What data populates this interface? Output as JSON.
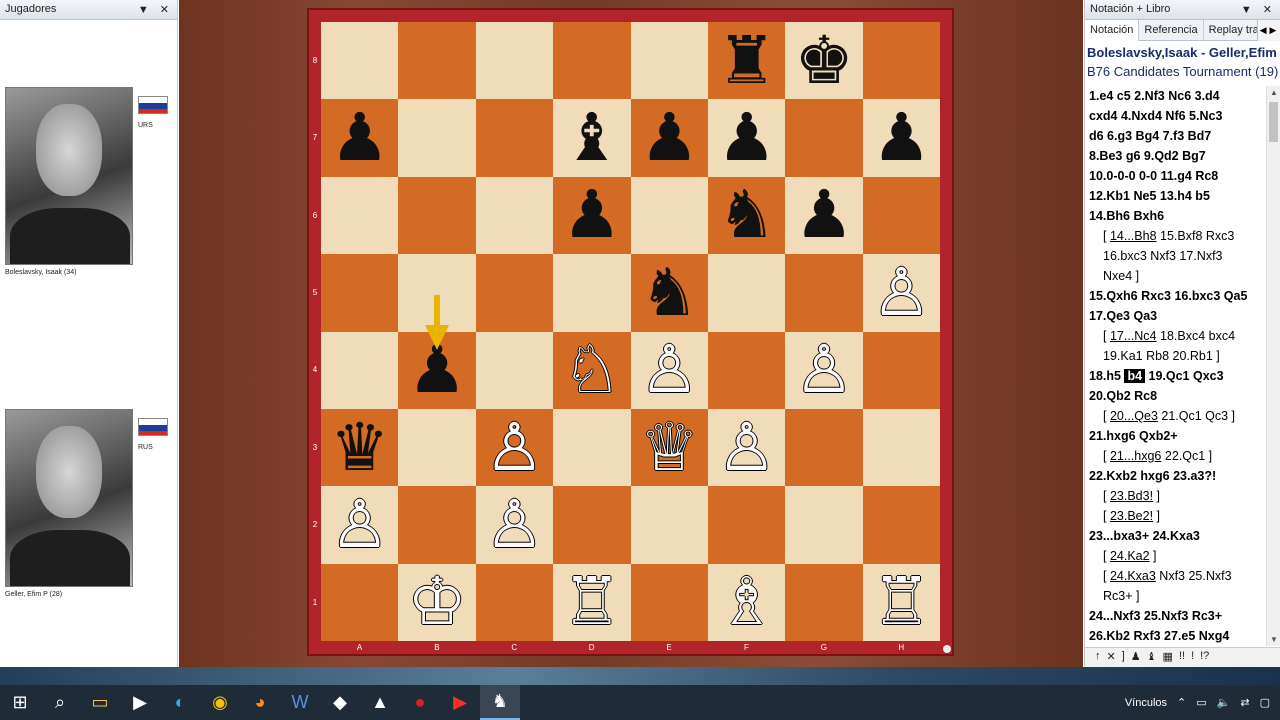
{
  "left_panel": {
    "title": "Jugadores",
    "players": [
      {
        "name": "Boleslavsky, Isaak  (34)",
        "country": "URS"
      },
      {
        "name": "Geller, Efim P  (28)",
        "country": "RUS"
      }
    ]
  },
  "board": {
    "ranks": [
      "8",
      "7",
      "6",
      "5",
      "4",
      "3",
      "2",
      "1"
    ],
    "files": [
      "A",
      "B",
      "C",
      "D",
      "E",
      "F",
      "G",
      "H"
    ],
    "pieces": [
      {
        "square": "f8",
        "glyph": "♜",
        "color": "b"
      },
      {
        "square": "g8",
        "glyph": "♚",
        "color": "b"
      },
      {
        "square": "a7",
        "glyph": "♟",
        "color": "b"
      },
      {
        "square": "d7",
        "glyph": "♝",
        "color": "b"
      },
      {
        "square": "e7",
        "glyph": "♟",
        "color": "b"
      },
      {
        "square": "f7",
        "glyph": "♟",
        "color": "b"
      },
      {
        "square": "h7",
        "glyph": "♟",
        "color": "b"
      },
      {
        "square": "d6",
        "glyph": "♟",
        "color": "b"
      },
      {
        "square": "f6",
        "glyph": "♞",
        "color": "b"
      },
      {
        "square": "g6",
        "glyph": "♟",
        "color": "b"
      },
      {
        "square": "e5",
        "glyph": "♞",
        "color": "b"
      },
      {
        "square": "h5",
        "glyph": "♙",
        "color": "w"
      },
      {
        "square": "b4",
        "glyph": "♟",
        "color": "b"
      },
      {
        "square": "d4",
        "glyph": "♘",
        "color": "w"
      },
      {
        "square": "e4",
        "glyph": "♙",
        "color": "w"
      },
      {
        "square": "g4",
        "glyph": "♙",
        "color": "w"
      },
      {
        "square": "a3",
        "glyph": "♛",
        "color": "b"
      },
      {
        "square": "c3",
        "glyph": "♙",
        "color": "w"
      },
      {
        "square": "e3",
        "glyph": "♕",
        "color": "w"
      },
      {
        "square": "f3",
        "glyph": "♙",
        "color": "w"
      },
      {
        "square": "a2",
        "glyph": "♙",
        "color": "w"
      },
      {
        "square": "c2",
        "glyph": "♙",
        "color": "w"
      },
      {
        "square": "b1",
        "glyph": "♔",
        "color": "w"
      },
      {
        "square": "d1",
        "glyph": "♖",
        "color": "w"
      },
      {
        "square": "f1",
        "glyph": "♗",
        "color": "w"
      },
      {
        "square": "h1",
        "glyph": "♖",
        "color": "w"
      }
    ],
    "last_move_arrow": {
      "from": "b5",
      "to": "b4",
      "color": "#e8b400"
    }
  },
  "right_panel": {
    "title": "Notación + Libro",
    "tabs": [
      "Notación",
      "Referencia",
      "Replay train"
    ],
    "white": "Boleslavsky,Isaak",
    "black": "Geller,Efim P",
    "event": "B76 Candidates Tournament (19)",
    "lines": [
      {
        "type": "main",
        "tokens": [
          {
            "t": "1.e4  c5  2.Nf3  Nc6  3.d4"
          }
        ]
      },
      {
        "type": "main",
        "tokens": [
          {
            "t": "cxd4  4.Nxd4  Nf6  5.Nc3"
          }
        ]
      },
      {
        "type": "main",
        "tokens": [
          {
            "t": "d6  6.g3  Bg4  7.f3  Bd7"
          }
        ]
      },
      {
        "type": "main",
        "tokens": [
          {
            "t": "8.Be3  g6  9.Qd2  Bg7"
          }
        ]
      },
      {
        "type": "main",
        "tokens": [
          {
            "t": "10.0-0-0  0-0  11.g4  Rc8"
          }
        ]
      },
      {
        "type": "main",
        "tokens": [
          {
            "t": "12.Kb1  Ne5  13.h4  b5"
          }
        ]
      },
      {
        "type": "main",
        "tokens": [
          {
            "t": "14.Bh6  Bxh6"
          }
        ]
      },
      {
        "type": "var",
        "tokens": [
          {
            "t": "[ "
          },
          {
            "t": "14...Bh8",
            "s": "sub"
          },
          {
            "t": "  15.Bxf8  Rxc3"
          }
        ]
      },
      {
        "type": "var",
        "tokens": [
          {
            "t": "16.bxc3  Nxf3  17.Nxf3"
          }
        ]
      },
      {
        "type": "var",
        "tokens": [
          {
            "t": "Nxe4 ]"
          }
        ]
      },
      {
        "type": "main",
        "tokens": [
          {
            "t": "15.Qxh6  Rxc3  16.bxc3  Qa5"
          }
        ]
      },
      {
        "type": "main",
        "tokens": [
          {
            "t": "17.Qe3  Qa3"
          }
        ]
      },
      {
        "type": "var",
        "tokens": [
          {
            "t": "[ "
          },
          {
            "t": "17...Nc4",
            "s": "sub"
          },
          {
            "t": "  18.Bxc4  bxc4"
          }
        ]
      },
      {
        "type": "var",
        "tokens": [
          {
            "t": "19.Ka1  Rb8  20.Rb1 ]"
          }
        ]
      },
      {
        "type": "main",
        "tokens": [
          {
            "t": "18.h5  "
          },
          {
            "t": "b4",
            "s": "current"
          },
          {
            "t": "  19.Qc1  Qxc3"
          }
        ]
      },
      {
        "type": "main",
        "tokens": [
          {
            "t": "20.Qb2  Rc8"
          }
        ]
      },
      {
        "type": "var",
        "tokens": [
          {
            "t": "[ "
          },
          {
            "t": "20...Qe3",
            "s": "sub"
          },
          {
            "t": "  21.Qc1  Qc3 ]"
          }
        ]
      },
      {
        "type": "main",
        "tokens": [
          {
            "t": "21.hxg6  Qxb2+"
          }
        ]
      },
      {
        "type": "var",
        "tokens": [
          {
            "t": "[ "
          },
          {
            "t": "21...hxg6",
            "s": "sub"
          },
          {
            "t": "  22.Qc1 ]"
          }
        ]
      },
      {
        "type": "main",
        "tokens": [
          {
            "t": "22.Kxb2  hxg6  23.a3?!"
          }
        ]
      },
      {
        "type": "var",
        "tokens": [
          {
            "t": "[ "
          },
          {
            "t": "23.Bd3!",
            "s": "sub"
          },
          {
            "t": " ]"
          }
        ]
      },
      {
        "type": "var",
        "tokens": [
          {
            "t": "[ "
          },
          {
            "t": "23.Be2!",
            "s": "sub"
          },
          {
            "t": " ]"
          }
        ]
      },
      {
        "type": "main",
        "tokens": [
          {
            "t": "23...bxa3+  24.Kxa3"
          }
        ]
      },
      {
        "type": "var",
        "tokens": [
          {
            "t": "[ "
          },
          {
            "t": "24.Ka2",
            "s": "sub"
          },
          {
            "t": " ]"
          }
        ]
      },
      {
        "type": "var",
        "tokens": [
          {
            "t": "[ "
          },
          {
            "t": "24.Kxa3",
            "s": "sub"
          },
          {
            "t": "  Nxf3  25.Nxf3"
          }
        ]
      },
      {
        "type": "var",
        "tokens": [
          {
            "t": "Rc3+ ]"
          }
        ]
      },
      {
        "type": "main",
        "tokens": [
          {
            "t": "24...Nxf3  25.Nxf3  Rc3+"
          }
        ]
      },
      {
        "type": "main",
        "tokens": [
          {
            "t": "26.Kb2  Rxf3  27.e5  Nxg4"
          }
        ]
      }
    ],
    "annotations": [
      "↑",
      "✕",
      "]",
      "♟",
      "♝",
      "▦",
      "!!",
      "!",
      "!?"
    ]
  },
  "taskbar": {
    "icons": [
      "windows-start-icon",
      "search-icon",
      "file-explorer-icon",
      "media-icon",
      "edge-icon",
      "chrome-icon",
      "firefox-icon",
      "word-icon",
      "notes-icon",
      "app-icon",
      "record-icon",
      "youtube-icon",
      "chessbase-icon"
    ],
    "tray_text": "Vínculos"
  }
}
